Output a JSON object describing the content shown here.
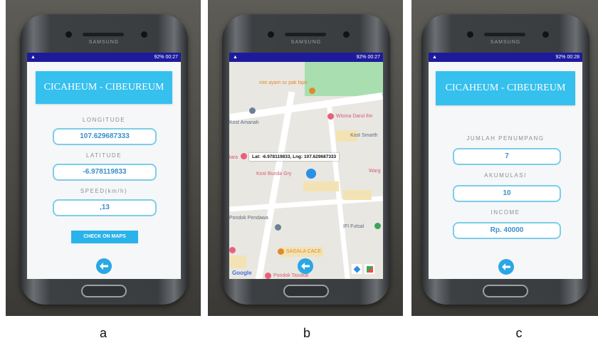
{
  "captions": [
    "a",
    "b",
    "c"
  ],
  "phone": {
    "brand": "SAMSUNG"
  },
  "status_bar": {
    "a": "92% 00:27",
    "b": "92% 00:27",
    "c": "92% 00:28"
  },
  "screen_a": {
    "route_title": "CICAHEUM - CIBEUREUM",
    "longitude_label": "LONGITUDE",
    "longitude_value": "107.629687333",
    "latitude_label": "LATITUDE",
    "latitude_value": "-6.978119833",
    "speed_label": "SPEED(km/h)",
    "speed_value": ",13",
    "check_maps_label": "CHECK ON MAPS"
  },
  "screen_b": {
    "marker_info": "Lat: -6.978119833, Lng: 107.629687333",
    "pois": [
      "mie ayam sc pak fajar",
      "Wisma Darul Ilm",
      "Kost Amanah",
      "Kost Smarth",
      "Kost Bunda Gry",
      "Warg",
      "tara",
      "Pondok Pendawa",
      "IFI Futsal",
      "SAGALA CACE",
      "Pondok Tasokal"
    ],
    "google_logo": "Google"
  },
  "screen_c": {
    "route_title": "CICAHEUM - CIBEUREUM",
    "passengers_label": "JUMLAH PENUMPANG",
    "passengers_value": "7",
    "accumulation_label": "AKUMULASI",
    "accumulation_value": "10",
    "income_label": "INCOME",
    "income_value": "Rp. 40000"
  },
  "colors": {
    "accent": "#35c0ee",
    "status_bar": "#1d1b9c",
    "value_text": "#3b8fc8"
  }
}
